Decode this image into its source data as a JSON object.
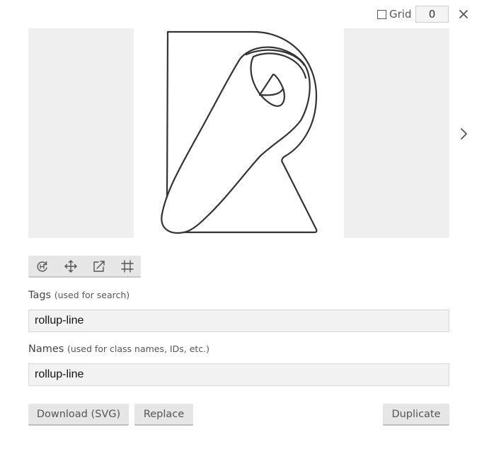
{
  "header": {
    "grid_label": "Grid",
    "grid_checked": false,
    "grid_value": "0",
    "close_icon": "close-icon"
  },
  "preview": {
    "glyph_icon": "rollup-line-glyph",
    "next_icon": "chevron-right-icon"
  },
  "toolbar": {
    "tools": [
      "rotate-icon",
      "move-icon",
      "resize-icon",
      "crop-grid-icon"
    ]
  },
  "tags": {
    "label": "Tags",
    "hint": "(used for search)",
    "value": "rollup-line"
  },
  "names": {
    "label": "Names",
    "hint": "(used for class names, IDs, etc.)",
    "value": "rollup-line"
  },
  "actions": {
    "download_label": "Download (SVG)",
    "replace_label": "Replace",
    "duplicate_label": "Duplicate"
  }
}
